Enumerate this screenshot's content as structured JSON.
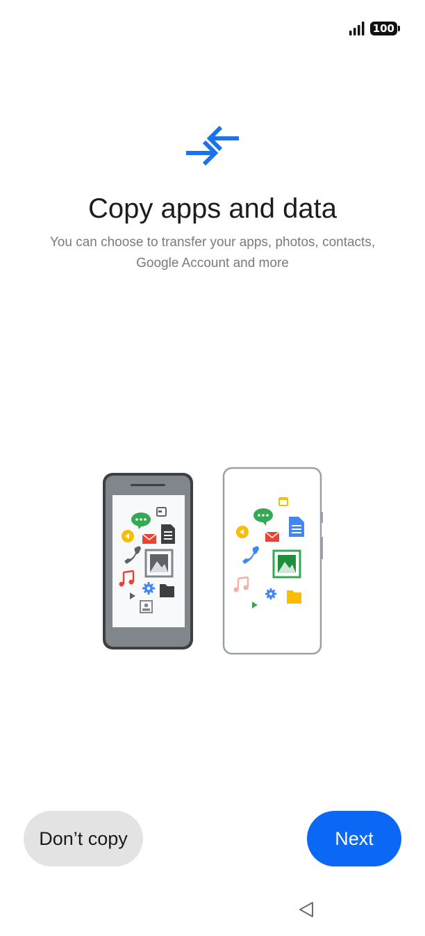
{
  "status_bar": {
    "battery_level": "100"
  },
  "header": {
    "icon": "transfer-arrows-icon",
    "title": "Copy apps and data",
    "subtitle": "You can choose to transfer your apps, photos, contacts, Google Account and more"
  },
  "illustration": {
    "icons": [
      "message-icon",
      "calendar-icon",
      "audio-icon",
      "mail-icon",
      "document-icon",
      "phone-icon",
      "photo-icon",
      "music-icon",
      "settings-icon",
      "folder-icon",
      "play-icon",
      "contact-icon"
    ]
  },
  "actions": {
    "secondary_label": "Don’t copy",
    "primary_label": "Next"
  },
  "nav": {
    "back_icon": "back-triangle-icon"
  },
  "colors": {
    "primary": "#0a68f5",
    "secondary_bg": "#e3e3e3",
    "hero_blue": "#1a73e8"
  }
}
